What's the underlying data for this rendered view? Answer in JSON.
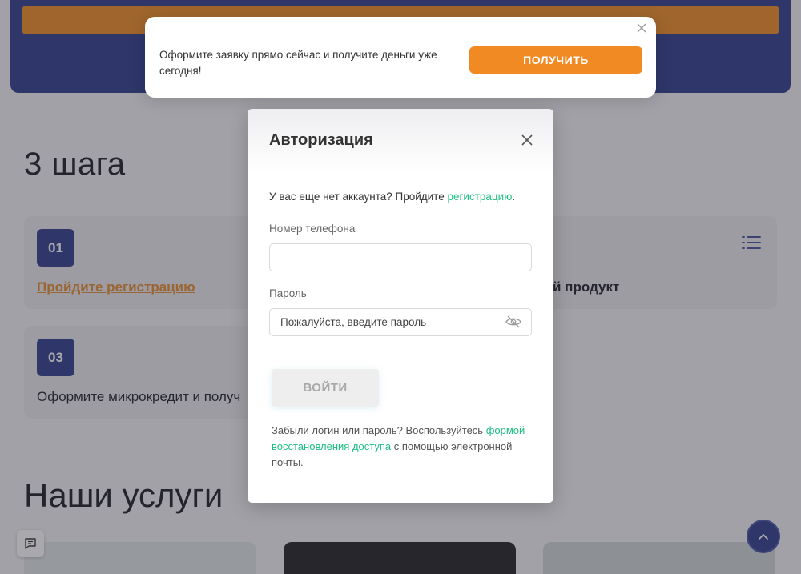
{
  "background": {
    "steps_heading": "3 шага",
    "steps": [
      {
        "num": "01",
        "text": "Пройдите регистрацию"
      },
      {
        "num": "",
        "text": "й продукт"
      },
      {
        "num": "03",
        "text": "Оформите микрокредит и получ"
      }
    ],
    "services_heading": "Наши услуги"
  },
  "promo": {
    "text": "Оформите заявку прямо сейчас и получите деньги уже сегодня!",
    "button": "ПОЛУЧИТЬ"
  },
  "modal": {
    "title": "Авторизация",
    "register_prefix": "У вас еще нет аккаунта? Пройдите ",
    "register_link": "регистрацию",
    "register_suffix": ".",
    "phone_label": "Номер телефона",
    "phone_value": "",
    "password_label": "Пароль",
    "password_placeholder": "Пожалуйста, введите пароль",
    "login_button": "ВОЙТИ",
    "forgot_prefix": "Забыли логин или пароль? Воспользуйтесь ",
    "forgot_link": "формой восстановления доступа",
    "forgot_suffix": " с помощью электронной почты."
  },
  "icons": [
    "list-icon",
    "close-icon",
    "eye-off-icon",
    "chat-icon",
    "arrow-up-icon"
  ],
  "colors": {
    "accent_orange": "#f28a24",
    "brand_blue": "#2b3a8c",
    "link_green": "#1fbf84"
  }
}
